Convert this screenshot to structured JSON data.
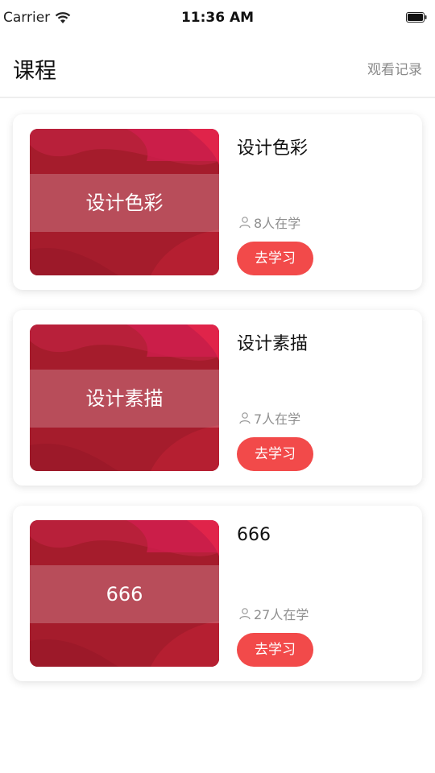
{
  "status_bar": {
    "carrier": "Carrier",
    "time": "11:36 AM"
  },
  "header": {
    "title": "课程",
    "history_label": "观看记录"
  },
  "courses": [
    {
      "title": "设计色彩",
      "thumb_label": "设计色彩",
      "learners": "8人在学",
      "button_label": "去学习"
    },
    {
      "title": "设计素描",
      "thumb_label": "设计素描",
      "learners": "7人在学",
      "button_label": "去学习"
    },
    {
      "title": "666",
      "thumb_label": "666",
      "learners": "27人在学",
      "button_label": "去学习"
    }
  ],
  "colors": {
    "accent": "#f24a4a",
    "thumb_base": "#a51c2c",
    "muted_text": "#8f8f8f"
  }
}
